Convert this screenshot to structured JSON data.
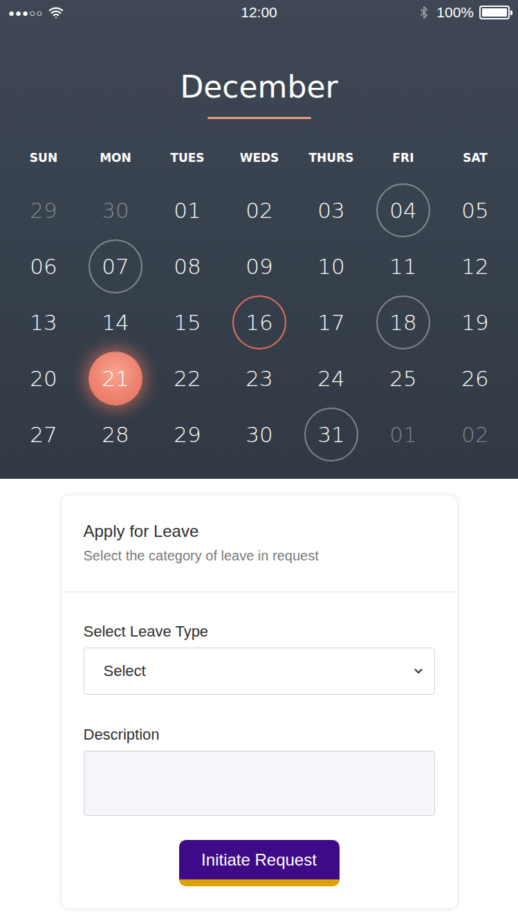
{
  "status_bar": {
    "signal": "●●●○○",
    "time": "12:00",
    "battery": "100%",
    "battery_level": 1
  },
  "calendar": {
    "month": "December",
    "weekdays": [
      "SUN",
      "MON",
      "TUES",
      "WEDS",
      "THURS",
      "FRI",
      "SAT"
    ],
    "weeks": [
      [
        {
          "label": "29",
          "muted": true,
          "kind": "plain"
        },
        {
          "label": "30",
          "muted": true,
          "kind": "plain"
        },
        {
          "label": "01",
          "muted": false,
          "kind": "plain"
        },
        {
          "label": "02",
          "muted": false,
          "kind": "plain"
        },
        {
          "label": "03",
          "muted": false,
          "kind": "plain"
        },
        {
          "label": "04",
          "muted": false,
          "kind": "event"
        },
        {
          "label": "05",
          "muted": false,
          "kind": "plain"
        }
      ],
      [
        {
          "label": "06",
          "muted": false,
          "kind": "plain"
        },
        {
          "label": "07",
          "muted": false,
          "kind": "event"
        },
        {
          "label": "08",
          "muted": false,
          "kind": "plain"
        },
        {
          "label": "09",
          "muted": false,
          "kind": "plain"
        },
        {
          "label": "10",
          "muted": false,
          "kind": "plain"
        },
        {
          "label": "11",
          "muted": false,
          "kind": "plain"
        },
        {
          "label": "12",
          "muted": false,
          "kind": "plain"
        }
      ],
      [
        {
          "label": "13",
          "muted": false,
          "kind": "plain"
        },
        {
          "label": "14",
          "muted": false,
          "kind": "plain"
        },
        {
          "label": "15",
          "muted": false,
          "kind": "plain"
        },
        {
          "label": "16",
          "muted": false,
          "kind": "reminder"
        },
        {
          "label": "17",
          "muted": false,
          "kind": "plain"
        },
        {
          "label": "18",
          "muted": false,
          "kind": "event"
        },
        {
          "label": "19",
          "muted": false,
          "kind": "plain"
        }
      ],
      [
        {
          "label": "20",
          "muted": false,
          "kind": "plain"
        },
        {
          "label": "21",
          "muted": false,
          "kind": "selected"
        },
        {
          "label": "22",
          "muted": false,
          "kind": "plain"
        },
        {
          "label": "23",
          "muted": false,
          "kind": "plain"
        },
        {
          "label": "24",
          "muted": false,
          "kind": "plain"
        },
        {
          "label": "25",
          "muted": false,
          "kind": "plain"
        },
        {
          "label": "26",
          "muted": false,
          "kind": "plain"
        }
      ],
      [
        {
          "label": "27",
          "muted": false,
          "kind": "plain"
        },
        {
          "label": "28",
          "muted": false,
          "kind": "plain"
        },
        {
          "label": "29",
          "muted": false,
          "kind": "plain"
        },
        {
          "label": "30",
          "muted": false,
          "kind": "plain"
        },
        {
          "label": "31",
          "muted": false,
          "kind": "event"
        },
        {
          "label": "01",
          "muted": true,
          "kind": "plain"
        },
        {
          "label": "02",
          "muted": true,
          "kind": "plain"
        }
      ]
    ]
  },
  "leave_form": {
    "title": "Apply for Leave",
    "subtitle": "Select the category of leave in request",
    "leave_type": {
      "label": "Select Leave Type",
      "value": "Select"
    },
    "description": {
      "label": "Description",
      "value": ""
    },
    "submit": "Initiate Request"
  }
}
